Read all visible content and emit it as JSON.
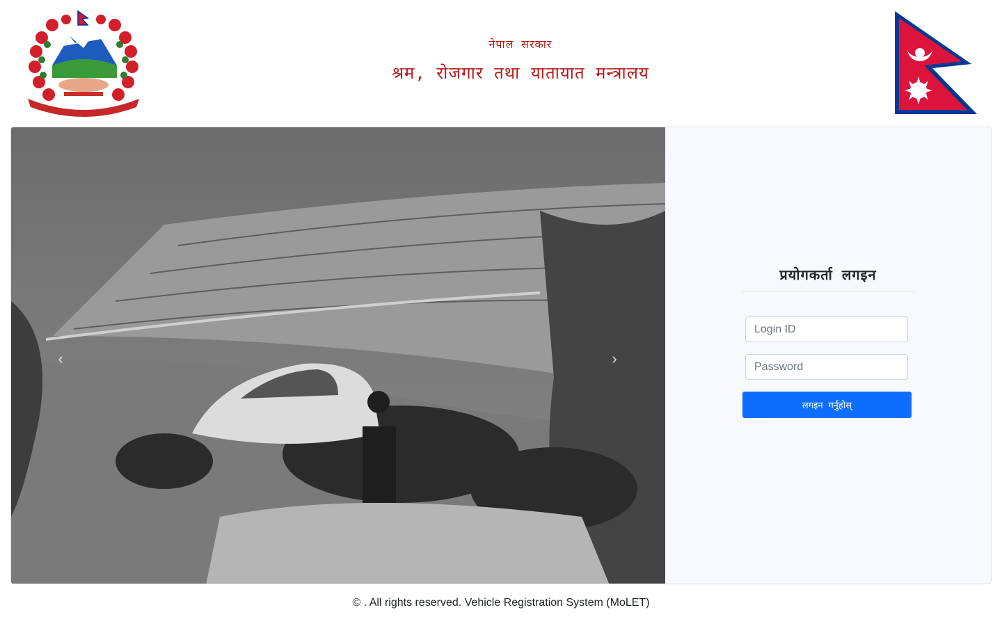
{
  "header": {
    "subtitle": "नेपाल सरकार",
    "title": "श्रम, रोजगार तथा यातायात मन्त्रालय",
    "emblem_icon": "nepal-emblem-icon",
    "flag_icon": "nepal-flag-icon"
  },
  "carousel": {
    "prev_label": "Previous",
    "next_label": "Next",
    "prev_icon": "chevron-left-icon",
    "next_icon": "chevron-right-icon"
  },
  "login": {
    "title": "प्रयोगकर्ता लगइन",
    "login_id_placeholder": "Login ID",
    "password_placeholder": "Password",
    "submit_label": "लगइन गर्नुहोस्"
  },
  "footer": {
    "text": "© . All rights reserved. Vehicle Registration System (MoLET)"
  },
  "colors": {
    "title_red": "#b31b1b",
    "button_blue": "#0d6efd",
    "flag_crimson": "#dc143c",
    "flag_blue": "#003893"
  }
}
